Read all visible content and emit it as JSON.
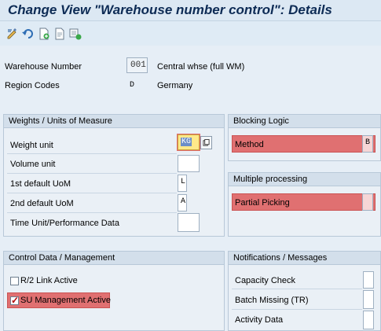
{
  "title": "Change View \"Warehouse number control\": Details",
  "toolbar": {
    "buttons": [
      "edit-toggle-icon",
      "undo-icon",
      "new-entry-icon",
      "copy-entry-icon",
      "select-icon"
    ]
  },
  "header": {
    "warehouse_label": "Warehouse Number",
    "warehouse_value": "001",
    "warehouse_desc": "Central whse (full WM)",
    "region_label": "Region Codes",
    "region_value": "D",
    "region_desc": "Germany"
  },
  "weights": {
    "title": "Weights / Units of Measure",
    "rows": [
      {
        "label": "Weight unit",
        "value": "KG"
      },
      {
        "label": "Volume unit",
        "value": ""
      },
      {
        "label": "1st default UoM",
        "value": "L"
      },
      {
        "label": "2nd default UoM",
        "value": "A"
      },
      {
        "label": "Time Unit/Performance Data",
        "value": ""
      }
    ]
  },
  "blocking": {
    "title": "Blocking Logic",
    "method_label": "Method",
    "method_value": "B"
  },
  "multiple": {
    "title": "Multiple processing",
    "partial_label": "Partial Picking",
    "partial_value": ""
  },
  "control": {
    "title": "Control Data / Management",
    "r2_label": "R/2 Link Active",
    "r2_checked": false,
    "su_label": "SU Management Active",
    "su_checked": true
  },
  "notifications": {
    "title": "Notifications / Messages",
    "rows": [
      {
        "label": "Capacity Check",
        "value": ""
      },
      {
        "label": "Batch Missing (TR)",
        "value": ""
      },
      {
        "label": "Activity Data",
        "value": ""
      }
    ]
  },
  "colors": {
    "highlight": "#e06a6a",
    "title": "#0d2b55",
    "focus_field": "#ffe98a"
  }
}
